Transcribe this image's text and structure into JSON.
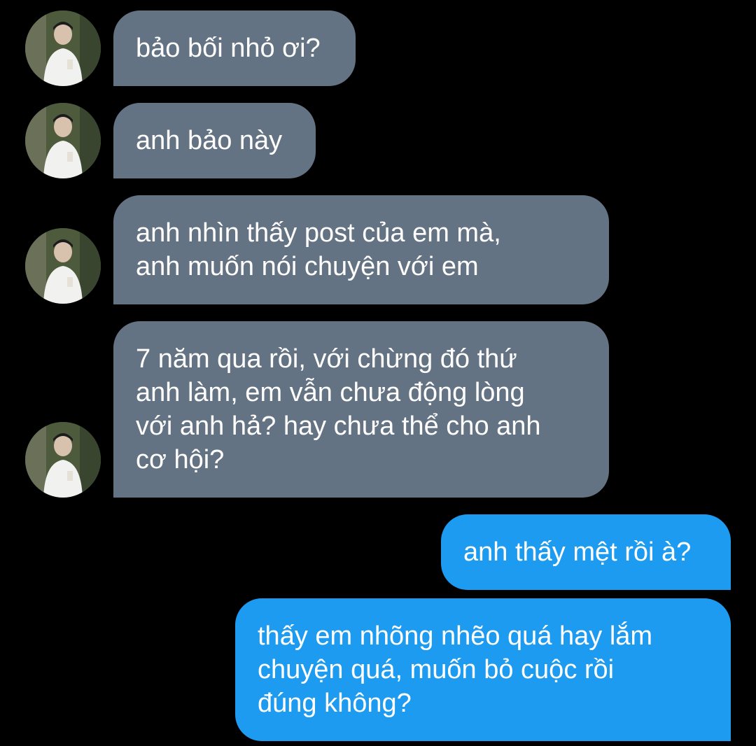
{
  "conversation": {
    "messages": [
      {
        "direction": "incoming",
        "lines": [
          "bảo bối nhỏ ơi?"
        ]
      },
      {
        "direction": "incoming",
        "lines": [
          "anh bảo này"
        ]
      },
      {
        "direction": "incoming",
        "lines": [
          "anh nhìn thấy post của em mà,",
          "anh muốn nói chuyện với em"
        ]
      },
      {
        "direction": "incoming",
        "lines": [
          "7 năm qua rồi, với chừng đó thứ",
          "anh làm, em vẫn chưa động lòng",
          "với anh hả? hay chưa thể cho anh",
          "cơ hội?"
        ]
      },
      {
        "direction": "outgoing",
        "lines": [
          "anh thấy mệt rồi à?"
        ]
      },
      {
        "direction": "outgoing",
        "lines": [
          "thấy em nhõng nhẽo quá hay lắm",
          "chuyện quá, muốn bỏ cuộc rồi",
          "đúng không?"
        ]
      }
    ]
  },
  "colors": {
    "background": "#000000",
    "incoming_bubble": "#647383",
    "outgoing_bubble": "#1d9bf0",
    "text": "#ffffff"
  },
  "icons": {
    "avatar": "contact-profile-photo"
  }
}
